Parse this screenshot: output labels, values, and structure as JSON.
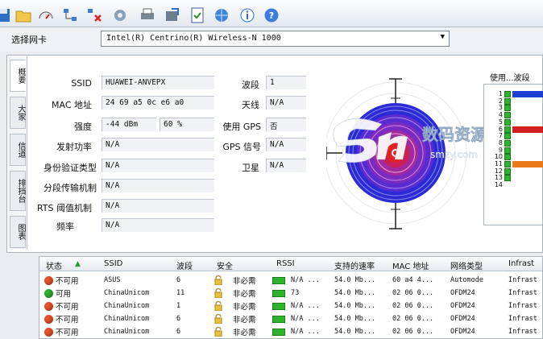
{
  "toolbar": {
    "icons": [
      "save-icon",
      "open-folder-icon",
      "gauge-icon",
      "network-icon",
      "disconnect-icon",
      "tools-icon",
      "printer-icon",
      "export-icon",
      "checklist-icon",
      "globe-icon",
      "info-icon",
      "help-icon"
    ]
  },
  "adapter": {
    "label": "选择网卡",
    "selected": "Intel(R) Centrino(R) Wireless-N 1000"
  },
  "tabs": [
    "概要",
    "大家",
    "信道",
    "排挡台",
    "图表"
  ],
  "info": {
    "ssid_label": "SSID",
    "ssid": "HUAWEI-ANVEPX",
    "mac_label": "MAC 地址",
    "mac": "24 69 a5 0c e6 a0",
    "signal_label": "强度",
    "signal_dbm": "-44 dBm",
    "signal_pct": "60 %",
    "tx_label": "发射功率",
    "tx": "N/A",
    "auth_label": "身份验证类型",
    "auth": "N/A",
    "frag_label": "分段传输机制",
    "frag": "N/A",
    "rts_label": "RTS 阈值机制",
    "rts": "N/A",
    "freq_label": "频率",
    "freq": "N/A",
    "band_label": "波段",
    "band": "1",
    "antenna_label": "天线",
    "antenna": "N/A",
    "gps_use_label": "使用 GPS",
    "gps_use": "否",
    "gps_signal_label": "GPS 信号",
    "gps_signal": "N/A",
    "satellite_label": "卫星",
    "satellite": "N/A"
  },
  "channels": {
    "title": "使用...波段",
    "numbers": [
      "1",
      "2",
      "3",
      "4",
      "5",
      "6",
      "7",
      "8",
      "9",
      "10",
      "11",
      "12",
      "13",
      "14"
    ],
    "bar_colors": {
      "ch1": "#1f3fd0",
      "ch6": "#d01f1f",
      "ch11": "#e87a1a"
    }
  },
  "watermark": {
    "text": "数码资源网",
    "url": "smzy.com"
  },
  "list": {
    "headers": [
      "状态",
      "SSID",
      "波段",
      "安全",
      "RSSI",
      "支持的速率",
      "MAC 地址",
      "网络类型",
      "Infrast"
    ],
    "rows": [
      {
        "status": "不可用",
        "status_color": "#e8502a",
        "ssid": "ASUS",
        "band": "6",
        "security": "非必需",
        "rssi": "N/A ...",
        "rate": "54.0 Mb...",
        "mac": "60 a4 4...",
        "type": "Automode",
        "infra": "Infrast"
      },
      {
        "status": "可用",
        "status_color": "#2fae2f",
        "ssid": "ChinaUnicom",
        "band": "11",
        "security": "非必需",
        "rssi": "73",
        "rate": "54.0 Mb...",
        "mac": "02 06 0...",
        "type": "OFDM24",
        "infra": "Infrast"
      },
      {
        "status": "不可用",
        "status_color": "#e8502a",
        "ssid": "ChinaUnicom",
        "band": "1",
        "security": "非必需",
        "rssi": "N/A ...",
        "rate": "54.0 Mb...",
        "mac": "02 06 0...",
        "type": "OFDM24",
        "infra": "Infrast"
      },
      {
        "status": "不可用",
        "status_color": "#e8502a",
        "ssid": "ChinaUnicom",
        "band": "6",
        "security": "非必需",
        "rssi": "N/A ...",
        "rate": "54.0 Mb...",
        "mac": "02 06 0...",
        "type": "OFDM24",
        "infra": "Infrast"
      },
      {
        "status": "不可用",
        "status_color": "#e8502a",
        "ssid": "ChinaUnicom",
        "band": "6",
        "security": "非必需",
        "rssi": "N/A ...",
        "rate": "54.0 Mb...",
        "mac": "02 06 0...",
        "type": "OFDM24",
        "infra": "Infrast"
      }
    ]
  }
}
